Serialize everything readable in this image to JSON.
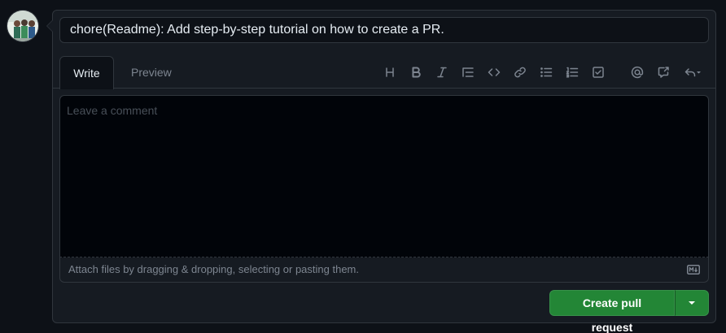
{
  "title_input": {
    "value": "chore(Readme): Add step-by-step tutorial on how to create a PR."
  },
  "tabs": [
    {
      "label": "Write"
    },
    {
      "label": "Preview"
    }
  ],
  "toolbar": {
    "icons": [
      "heading-icon",
      "bold-icon",
      "italic-icon",
      "quote-icon",
      "code-icon",
      "link-icon",
      "unordered-list-icon",
      "ordered-list-icon",
      "task-list-icon",
      "mention-icon",
      "cross-reference-icon",
      "saved-replies-icon"
    ]
  },
  "comment": {
    "placeholder": "Leave a comment",
    "attach_hint": "Attach files by dragging & dropping, selecting or pasting them."
  },
  "actions": {
    "create_label": "Create pull request"
  },
  "colors": {
    "accent_green": "#238636",
    "background": "#0d1117",
    "panel": "#161b22",
    "border": "#30363d",
    "muted_text": "#7d8590"
  }
}
